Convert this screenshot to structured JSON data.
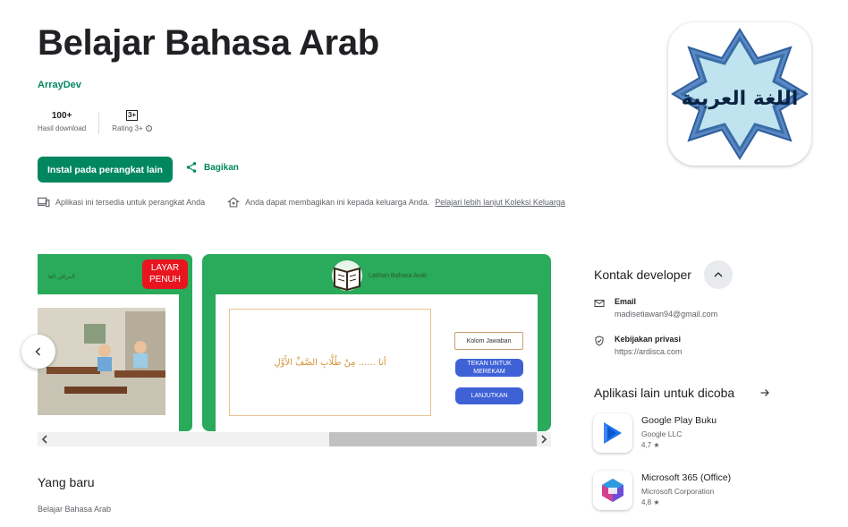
{
  "app": {
    "title": "Belajar Bahasa Arab",
    "developer": "ArrayDev",
    "downloads_value": "100+",
    "downloads_label": "Hasil download",
    "rating_badge": "3+",
    "rating_label": "Rating 3+",
    "icon_text": "اللغة العربية"
  },
  "actions": {
    "install_label": "Instal pada perangkat lain",
    "share_label": "Bagikan"
  },
  "notes": {
    "device": "Aplikasi ini tersedia untuk perangkat Anda",
    "family": "Anda dapat membagikan ini kepada keluarga Anda.",
    "family_link": "Pelajari lebih lanjut Koleksi Keluarga"
  },
  "screenshots": {
    "shot1": {
      "badge_line1": "LAYAR",
      "badge_line2": "PENUH",
      "title": "المراقي العا"
    },
    "shot2": {
      "title": "Latihan Bahasa Arab",
      "question": "أنا ...... مِنْ طُلَّابِ الصَّفِّ الأَوَّلِ",
      "answer_placeholder": "Kolom Jawaban",
      "record_button": "TEKAN UNTUK MEREKAM",
      "next_button": "LANJUTKAN"
    }
  },
  "whats_new": {
    "heading": "Yang baru",
    "text": "Belajar Bahasa Arab"
  },
  "contact": {
    "heading": "Kontak developer",
    "email_label": "Email",
    "email_value": "madisetiawan94@gmail.com",
    "privacy_label": "Kebijakan privasi",
    "privacy_value": "https://ardisca.com"
  },
  "other_apps": {
    "heading": "Aplikasi lain untuk dicoba",
    "items": [
      {
        "name": "Google Play Buku",
        "developer": "Google LLC",
        "rating": "4,7 ★"
      },
      {
        "name": "Microsoft 365 (Office)",
        "developer": "Microsoft Corporation",
        "rating": "4,8 ★"
      }
    ]
  },
  "colors": {
    "brand_green": "#01875f",
    "screenshot_green": "#2aaa5b",
    "badge_red": "#e8151f",
    "button_blue": "#3e62d6"
  }
}
